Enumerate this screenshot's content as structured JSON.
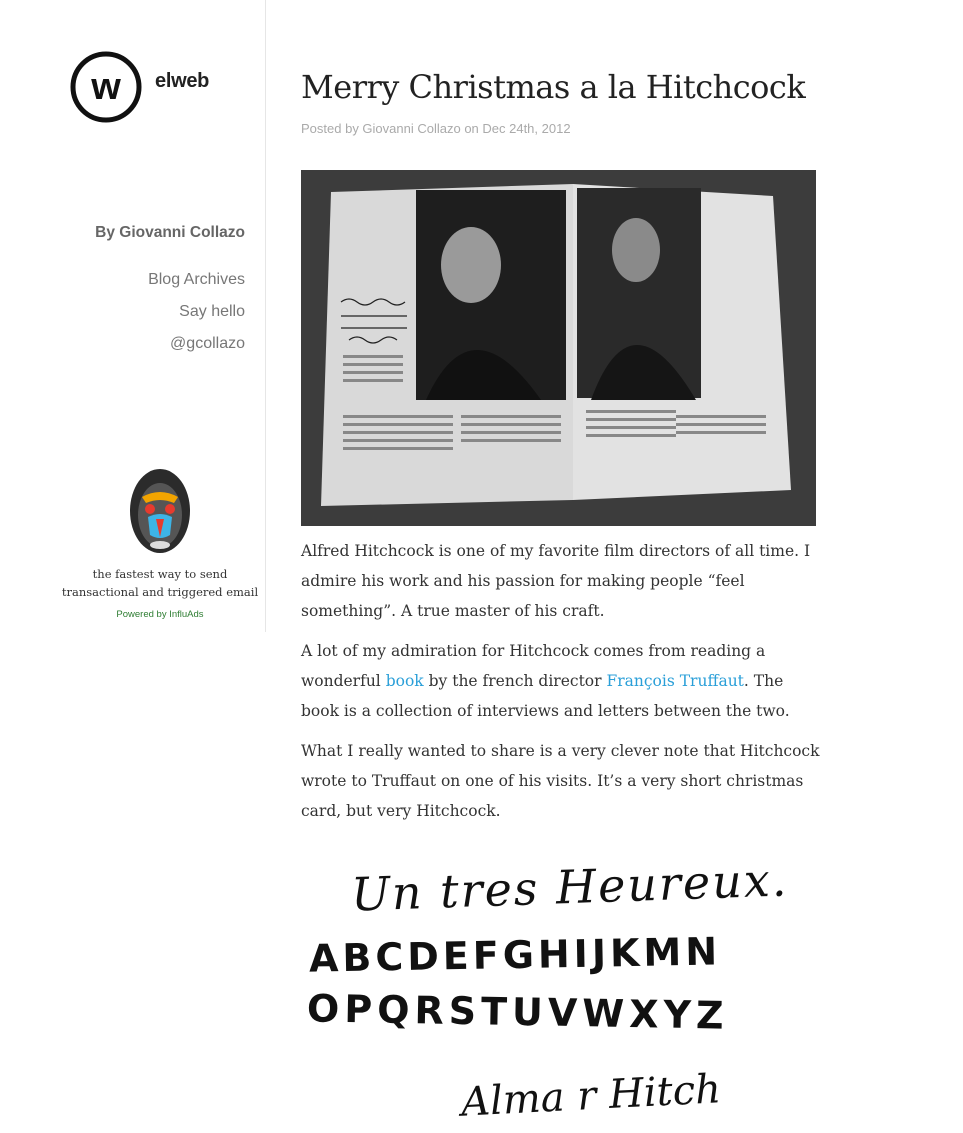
{
  "site": {
    "logo_letter": "w",
    "name": "elweb"
  },
  "sidebar": {
    "author": "By Giovanni Collazo",
    "nav": [
      {
        "label": "Blog Archives"
      },
      {
        "label": "Say hello"
      },
      {
        "label": "@gcollazo"
      }
    ]
  },
  "ad": {
    "text_line1": "the fastest way to send",
    "text_line2": "transactional and triggered email",
    "powered": "Powered by InfluAds",
    "icon": "mandrill-icon"
  },
  "post": {
    "title": "Merry Christmas a la Hitchcock",
    "meta": "Posted by Giovanni Collazo on Dec 24th, 2012",
    "paragraphs": {
      "p1": "Alfred Hitchcock is one of my favorite film directors of all time. I admire his work and his passion for making people “feel something”. A true master of his craft.",
      "p2_a": "A lot of my admiration for Hitchcock comes from reading a wonderful ",
      "p2_link1": "book",
      "p2_b": " by the french director ",
      "p2_link2": "François Truffaut",
      "p2_c": ". The book is a collection of interviews and letters between the two.",
      "p3": "What I really wanted to share is a very clever note that Hitchcock wrote to Truffaut on one of his visits. It’s a very short christmas card, but very Hitchcock."
    },
    "card": {
      "line1": "Un tres Heureux.",
      "line2": "ABCDEFGHIJKMN",
      "line3": "OPQRSTUVWXYZ",
      "line4": "Alma r Hitch"
    }
  },
  "colors": {
    "link": "#2a9fd8",
    "text": "#333333",
    "meta": "#aaaaaa",
    "powered": "#2e7d32"
  }
}
